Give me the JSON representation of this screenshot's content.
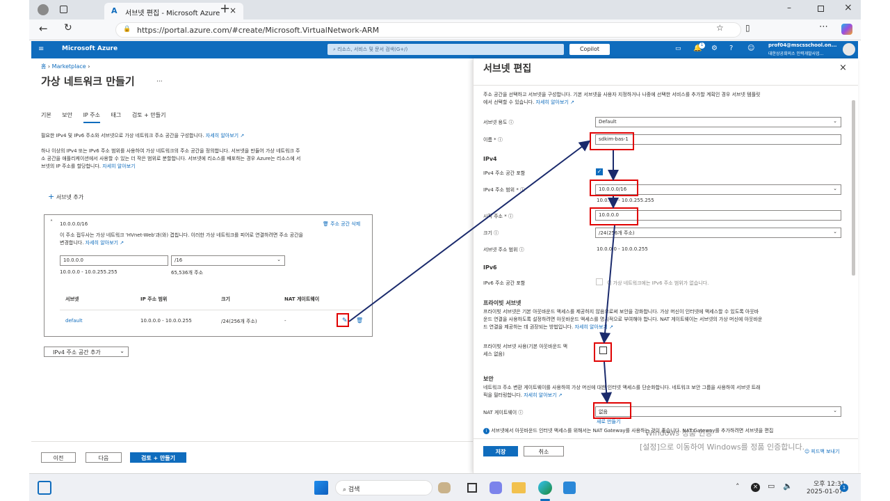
{
  "browser": {
    "tab_title": "서브넷 편집 - Microsoft Azure",
    "url": "https://portal.azure.com/#create/Microsoft.VirtualNetwork-ARM"
  },
  "azure": {
    "brand": "Microsoft Azure",
    "search_placeholder": "리소스, 서비스 및 문서 검색(G+/)",
    "copilot": "Copilot",
    "account_name": "prof04@mscsschool.on...",
    "account_org": "대한상공회의소 인력개발사업...",
    "notification_count": "1"
  },
  "main": {
    "breadcrumb_home": "홈",
    "breadcrumb_marketplace": "Marketplace",
    "title": "가상 네트워크 만들기",
    "more": "...",
    "tabs": [
      "기본",
      "보안",
      "IP 주소",
      "태그",
      "검토 + 만들기"
    ],
    "desc1": "필요한 IPv4 및 IPv6 주소와 서브넷으로 가상 네트워크 주소 공간을 구성합니다.",
    "learn_more": "자세히 알아보기",
    "desc2_line1": "하나 이상의 IPv4 또는 IPv6 주소 범위를 사용하여 가상 네트워크의 주소 공간을 정의합니다. 서브넷을 만들어 가상 네트워크 주",
    "desc2_line2": "소 공간을 애플리케이션에서 사용할 수 있는 더 작은 범위로 분할합니다. 서브넷에 리소스를 배포하는 경우 Azure는 리소스에 서",
    "desc2_line3": "브넷의 IP 주소를 할당합니다.",
    "add_subnet": "서브넷 추가",
    "address_space": {
      "title": "10.0.0.0/16",
      "delete": "주소 공간 삭제",
      "warning_line1": "이 주소 접두사는 가상 네트워크 'HVnet-Web'과(와) 겹칩니다. 이러한 가상 네트워크를 피어로 연결하려면 주소 공간을",
      "warning_line2": "변경합니다.",
      "ip": "10.0.0.0",
      "prefix": "/16",
      "range": "10.0.0.0 - 10.0.255.255",
      "count": "65,536개 주소",
      "columns": [
        "서브넷",
        "IP 주소 범위",
        "크기",
        "NAT 게이트웨이"
      ],
      "rows": [
        {
          "name": "default",
          "range": "10.0.0.0 - 10.0.0.255",
          "size": "/24(256개 주소)",
          "nat": "-"
        }
      ]
    },
    "add_ipv4": "IPv4 주소 공간 추가",
    "btn_prev": "이전",
    "btn_next": "다음",
    "btn_review": "검토 + 만들기"
  },
  "panel": {
    "title": "서브넷 편집",
    "intro_line1": "주소 공간을 선택하고 서브넷을 구성합니다. 기본 서브넷을 사용자 지정하거나 나중에 선택한 서비스를 추가할 계획인 경우 서브넷 템플릿",
    "intro_line2": "에서 선택할 수 있습니다.",
    "learn_more": "자세히 알아보기",
    "subnet_purpose_label": "서브넷 용도",
    "subnet_purpose": "Default",
    "name_label": "이름 *",
    "name": "sdkim-bas-1",
    "ipv4_header": "IPv4",
    "ipv4_include_label": "IPv4 주소 공간 포함",
    "ipv4_range_label": "IPv4 주소 범위 *",
    "ipv4_range": "10.0.0.0/16",
    "ipv4_range_hint": "10.0.0.0 - 10.0.255.255",
    "start_label": "시작 주소 *",
    "start": "10.0.0.0",
    "size_label": "크기",
    "size": "/24(256개 주소)",
    "subnet_range_label": "서브넷 주소 범위",
    "subnet_range": "10.0.0.0 - 10.0.0.255",
    "ipv6_header": "IPv6",
    "ipv6_include_label": "IPv6 주소 공간 포함",
    "ipv6_note": "이 가상 네트워크에는 IPv6 주소 범위가 없습니다.",
    "private_header": "프라이빗 서브넷",
    "private_line1": "프라이빗 서브넷은 기본 아웃바운드 액세스를 제공하지 않음으로써 보안을 강화합니다. 가상 머신이 인터넷에 액세스할 수 있도록 아웃바",
    "private_line2": "운드 연결을 사용하도록 설정하려면 아웃바운드 액세스를 명시적으로 부여해야 합니다. NAT 게이트웨이는 서브넷의 가상 머신에 아웃바운",
    "private_line3": "드 연결을 제공하는 데 권장되는 방법입니다.",
    "private_enable_line1": "프라이빗 서브넷 사용(기본 아웃바운드 액",
    "private_enable_line2": "세스 없음)",
    "security_header": "보안",
    "security_line1": "네트워크 주소 변환 게이트웨이를 사용하여 가상 머신에 대한 인터넷 액세스를 단순화합니다. 네트워크 보안 그룹을 사용하여 서브넷 트래",
    "security_line2": "픽을 필터링합니다.",
    "nat_label": "NAT 게이트웨이",
    "nat_value": "없음",
    "nat_create": "새로 만들기",
    "info_text": "서브넷에서 아웃바운드 인터넷 액세스를 위해서는 NAT Gateway를 사용하는 것이 좋습니다. NAT Gateway를 추가하려면 서브넷을 편집",
    "save": "저장",
    "cancel": "취소",
    "feedback": "피드백 보내기"
  },
  "watermark": {
    "line1": "Windows 정품 인증",
    "line2": "[설정]으로 이동하여 Windows를 정품 인증합니다."
  },
  "taskbar": {
    "search": "검색",
    "time": "오후 12:31",
    "date": "2025-01-07",
    "badge": "1"
  },
  "colors": {
    "accent": "#0f6cbd",
    "annotation": "#e00000",
    "arrow": "#1a2a6c"
  }
}
